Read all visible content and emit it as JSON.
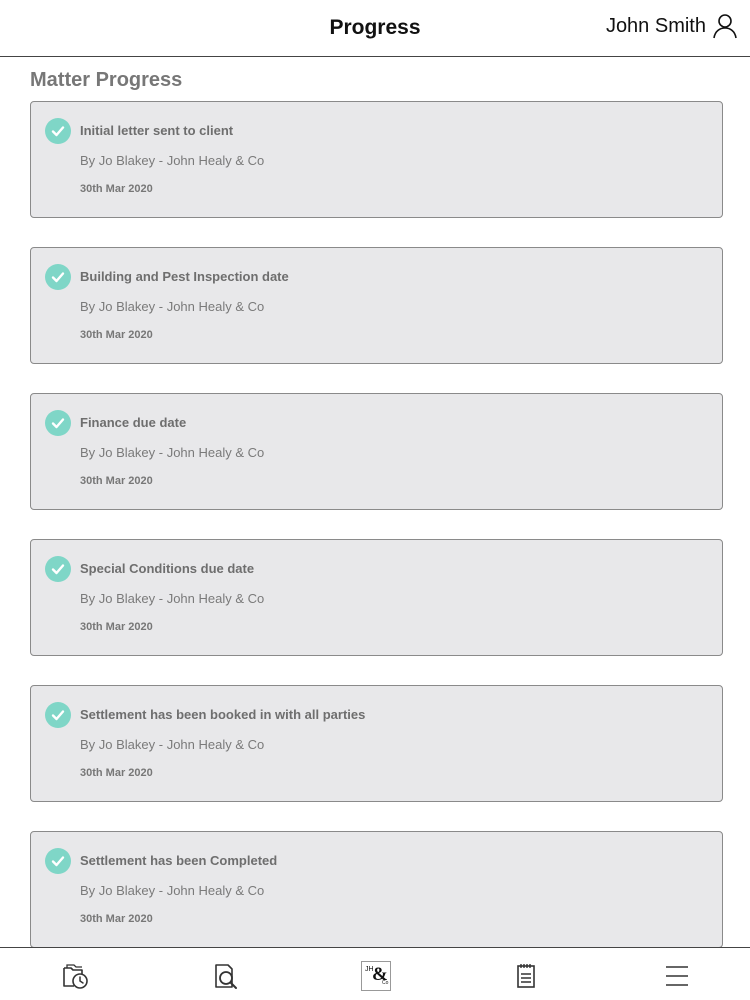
{
  "header": {
    "title": "Progress",
    "user_name": "John Smith",
    "user_icon": "user-icon"
  },
  "section": {
    "title": "Matter Progress"
  },
  "colors": {
    "check_accent": "#7fd6c7",
    "card_background": "#e8e8ea"
  },
  "progress_items": [
    {
      "title": "Initial letter sent to client",
      "by": "By Jo Blakey - John Healy & Co",
      "date": "30th Mar 2020",
      "status": "completed"
    },
    {
      "title": "Building and Pest Inspection date",
      "by": "By Jo Blakey - John Healy & Co",
      "date": "30th Mar 2020",
      "status": "completed"
    },
    {
      "title": "Finance due date",
      "by": "By Jo Blakey - John Healy & Co",
      "date": "30th Mar 2020",
      "status": "completed"
    },
    {
      "title": "Special Conditions due date",
      "by": "By Jo Blakey - John Healy & Co",
      "date": "30th Mar 2020",
      "status": "completed"
    },
    {
      "title": "Settlement has been booked in with all parties",
      "by": "By Jo Blakey - John Healy & Co",
      "date": "30th Mar 2020",
      "status": "completed"
    },
    {
      "title": "Settlement has been Completed",
      "by": "By Jo Blakey - John Healy & Co",
      "date": "30th Mar 2020",
      "status": "completed"
    }
  ],
  "bottom_nav": {
    "items": [
      {
        "icon": "clock-folder-icon"
      },
      {
        "icon": "document-search-icon"
      },
      {
        "icon": "logo-icon",
        "logo_text": {
          "jh": "JH",
          "amp": "&",
          "co": "Co"
        }
      },
      {
        "icon": "clipboard-icon"
      },
      {
        "icon": "menu-icon"
      }
    ]
  }
}
